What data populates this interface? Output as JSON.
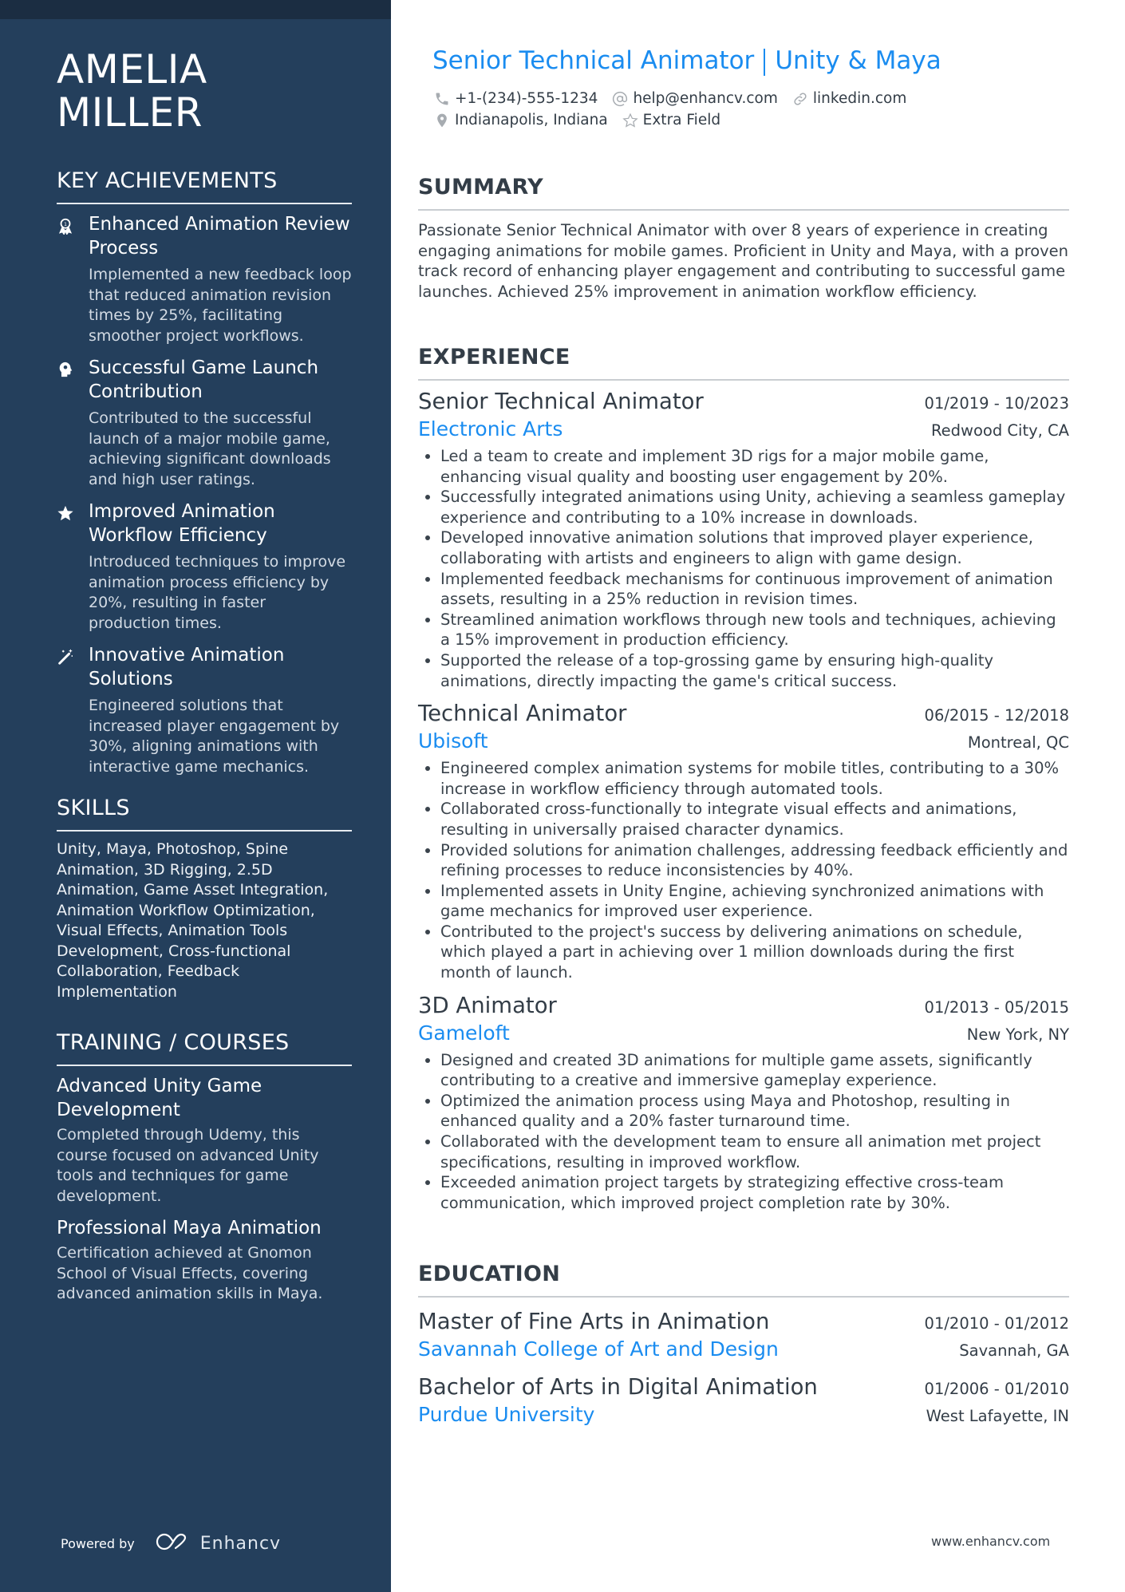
{
  "profile": {
    "first_name": "AMELIA",
    "last_name": "MILLER",
    "headline_role": "Senior Technical Animator",
    "headline_skills": "Unity & Maya",
    "contact": {
      "phone": "+1-(234)-555-1234",
      "email": "help@enhancv.com",
      "link": "linkedin.com",
      "location": "Indianapolis, Indiana",
      "extra": "Extra Field"
    }
  },
  "sidebar": {
    "achievements_heading": "KEY ACHIEVEMENTS",
    "achievements": [
      {
        "icon": "award-ribbon-icon",
        "title": "Enhanced Animation Review Process",
        "description": "Implemented a new feedback loop that reduced animation revision times by 25%, facilitating smoother project workflows."
      },
      {
        "icon": "head-brain-icon",
        "title": "Successful Game Launch Contribution",
        "description": "Contributed to the successful launch of a major mobile game, achieving significant downloads and high user ratings."
      },
      {
        "icon": "star-icon",
        "title": "Improved Animation Workflow Efficiency",
        "description": "Introduced techniques to improve animation process efficiency by 20%, resulting in faster production times."
      },
      {
        "icon": "magic-wand-icon",
        "title": "Innovative Animation Solutions",
        "description": "Engineered solutions that increased player engagement by 30%, aligning animations with interactive game mechanics."
      }
    ],
    "skills_heading": "SKILLS",
    "skills_text": "Unity, Maya, Photoshop, Spine Animation, 3D Rigging, 2.5D Animation, Game Asset Integration, Animation Workflow Optimization, Visual Effects, Animation Tools Development, Cross-functional Collaboration, Feedback Implementation",
    "training_heading": "TRAINING / COURSES",
    "courses": [
      {
        "title": "Advanced Unity Game Development",
        "description": "Completed through Udemy, this course focused on advanced Unity tools and techniques for game development."
      },
      {
        "title": "Professional Maya Animation",
        "description": "Certification achieved at Gnomon School of Visual Effects, covering advanced animation skills in Maya."
      }
    ],
    "powered_by": "Powered by",
    "brand": "Enhancv"
  },
  "main": {
    "summary_heading": "SUMMARY",
    "summary_text": "Passionate Senior Technical Animator with over 8 years of experience in creating engaging animations for mobile games. Proficient in Unity and Maya, with a proven track record of enhancing player engagement and contributing to successful game launches. Achieved 25% improvement in animation workflow efficiency.",
    "experience_heading": "EXPERIENCE",
    "jobs": [
      {
        "title": "Senior Technical Animator",
        "dates": "01/2019 - 10/2023",
        "company": "Electronic Arts",
        "location": "Redwood City, CA",
        "bullets": [
          "Led a team to create and implement 3D rigs for a major mobile game, enhancing visual quality and boosting user engagement by 20%.",
          "Successfully integrated animations using Unity, achieving a seamless gameplay experience and contributing to a 10% increase in downloads.",
          "Developed innovative animation solutions that improved player experience, collaborating with artists and engineers to align with game design.",
          "Implemented feedback mechanisms for continuous improvement of animation assets, resulting in a 25% reduction in revision times.",
          "Streamlined animation workflows through new tools and techniques, achieving a 15% improvement in production efficiency.",
          "Supported the release of a top-grossing game by ensuring high-quality animations, directly impacting the game's critical success."
        ]
      },
      {
        "title": "Technical Animator",
        "dates": "06/2015 - 12/2018",
        "company": "Ubisoft",
        "location": "Montreal, QC",
        "bullets": [
          "Engineered complex animation systems for mobile titles, contributing to a 30% increase in workflow efficiency through automated tools.",
          "Collaborated cross-functionally to integrate visual effects and animations, resulting in universally praised character dynamics.",
          "Provided solutions for animation challenges, addressing feedback efficiently and refining processes to reduce inconsistencies by 40%.",
          "Implemented assets in Unity Engine, achieving synchronized animations with game mechanics for improved user experience.",
          "Contributed to the project's success by delivering animations on schedule, which played a part in achieving over 1 million downloads during the first month of launch."
        ]
      },
      {
        "title": "3D Animator",
        "dates": "01/2013 - 05/2015",
        "company": "Gameloft",
        "location": "New York, NY",
        "bullets": [
          "Designed and created 3D animations for multiple game assets, significantly contributing to a creative and immersive gameplay experience.",
          "Optimized the animation process using Maya and Photoshop, resulting in enhanced quality and a 20% faster turnaround time.",
          "Collaborated with the development team to ensure all animation met project specifications, resulting in improved workflow.",
          "Exceeded animation project targets by strategizing effective cross-team communication, which improved project completion rate by 30%."
        ]
      }
    ],
    "education_heading": "EDUCATION",
    "education": [
      {
        "degree": "Master of Fine Arts in Animation",
        "dates": "01/2010 - 01/2012",
        "school": "Savannah College of Art and Design",
        "location": "Savannah, GA"
      },
      {
        "degree": "Bachelor of Arts in Digital Animation",
        "dates": "01/2006 - 01/2010",
        "school": "Purdue University",
        "location": "West Lafayette, IN"
      }
    ],
    "footer_url": "www.enhancv.com"
  },
  "colors": {
    "sidebar_bg": "#243f5c",
    "accent_blue": "#1a8cf0",
    "text_dark": "#333d47"
  }
}
